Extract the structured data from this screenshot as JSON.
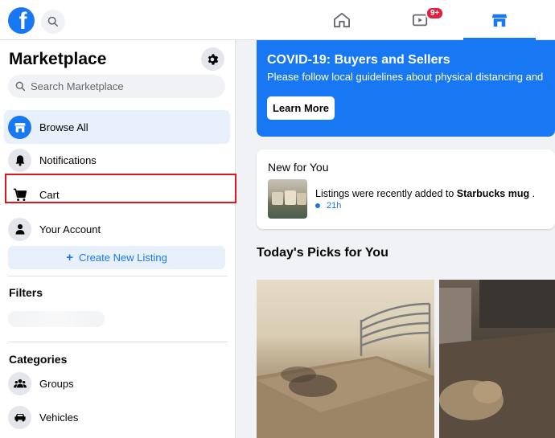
{
  "header": {
    "logo_letter": "f",
    "icons": [
      "facebook-logo",
      "search-icon",
      "home-icon",
      "watch-icon",
      "marketplace-icon"
    ],
    "watch_badge": "9+"
  },
  "sidebar": {
    "title": "Marketplace",
    "search_placeholder": "Search Marketplace",
    "items": [
      {
        "label": "Browse All",
        "icon": "storefront-icon",
        "active": true
      },
      {
        "label": "Notifications",
        "icon": "bell-icon"
      },
      {
        "label": "Cart",
        "icon": "cart-icon"
      },
      {
        "label": "Your Account",
        "icon": "person-icon"
      }
    ],
    "create_label": "Create New Listing",
    "filters_heading": "Filters",
    "categories_heading": "Categories",
    "categories": [
      {
        "label": "Groups",
        "icon": "groups-icon"
      },
      {
        "label": "Vehicles",
        "icon": "car-icon"
      }
    ]
  },
  "main": {
    "covid": {
      "title": "COVID-19: Buyers and Sellers",
      "body": "Please follow local guidelines about physical distancing and",
      "button": "Learn More"
    },
    "new_for_you": {
      "title": "New for You",
      "text_prefix": "Listings were recently added to ",
      "text_bold": "Starbucks mug",
      "text_suffix": " .",
      "time": "21h"
    },
    "picks_title": "Today's Picks for You"
  },
  "colors": {
    "accent": "#1877f2",
    "highlight_border": "#e0151c",
    "badge": "#e41e3f"
  }
}
